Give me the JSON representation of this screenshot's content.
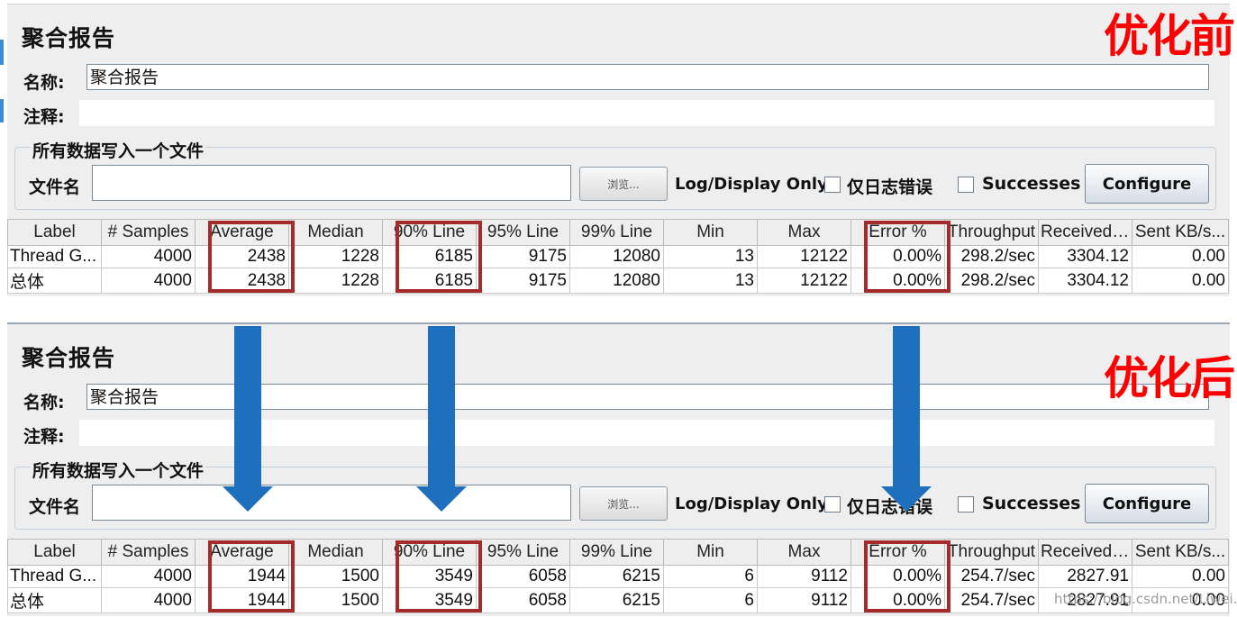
{
  "before": {
    "title": "聚合报告",
    "name_label": "名称:",
    "name_value": "聚合报告",
    "comment_label": "注释:",
    "file_group_legend": "所有数据写入一个文件",
    "file_label": "文件名",
    "browse_label": "浏览...",
    "log_display_label": "Log/Display Only:",
    "errors_only_label": "仅日志错误",
    "successes_label": "Successes",
    "configure_label": "Configure",
    "table": {
      "headers": [
        "Label",
        "# Samples",
        "Average",
        "Median",
        "90% Line",
        "95% Line",
        "99% Line",
        "Min",
        "Max",
        "Error %",
        "Throughput",
        "Received ...",
        "Sent KB/s..."
      ],
      "rows": [
        [
          "Thread G...",
          "4000",
          "2438",
          "1228",
          "6185",
          "9175",
          "12080",
          "13",
          "12122",
          "0.00%",
          "298.2/sec",
          "3304.12",
          "0.00"
        ],
        [
          "总体",
          "4000",
          "2438",
          "1228",
          "6185",
          "9175",
          "12080",
          "13",
          "12122",
          "0.00%",
          "298.2/sec",
          "3304.12",
          "0.00"
        ]
      ]
    }
  },
  "after": {
    "title": "聚合报告",
    "name_label": "名称:",
    "name_value": "聚合报告",
    "comment_label": "注释:",
    "file_group_legend": "所有数据写入一个文件",
    "file_label": "文件名",
    "browse_label": "浏览...",
    "log_display_label": "Log/Display Only:",
    "errors_only_label": "仅日志错误",
    "successes_label": "Successes",
    "configure_label": "Configure",
    "table": {
      "headers": [
        "Label",
        "# Samples",
        "Average",
        "Median",
        "90% Line",
        "95% Line",
        "99% Line",
        "Min",
        "Max",
        "Error %",
        "Throughput",
        "Received ...",
        "Sent KB/s..."
      ],
      "rows": [
        [
          "Thread G...",
          "4000",
          "1944",
          "1500",
          "3549",
          "6058",
          "6215",
          "6",
          "9112",
          "0.00%",
          "254.7/sec",
          "2827.91",
          "0.00"
        ],
        [
          "总体",
          "4000",
          "1944",
          "1500",
          "3549",
          "6058",
          "6215",
          "6",
          "9112",
          "0.00%",
          "254.7/sec",
          "2827.91",
          "0.00"
        ]
      ]
    }
  },
  "annotations": {
    "before_label": "优化前",
    "after_label": "优化后",
    "highlight_color": "#a52a2a",
    "arrow_color": "#1f6fbf",
    "label_color": "#ff0000"
  },
  "watermark": "https://blog.csdn.net/Liwei..."
}
